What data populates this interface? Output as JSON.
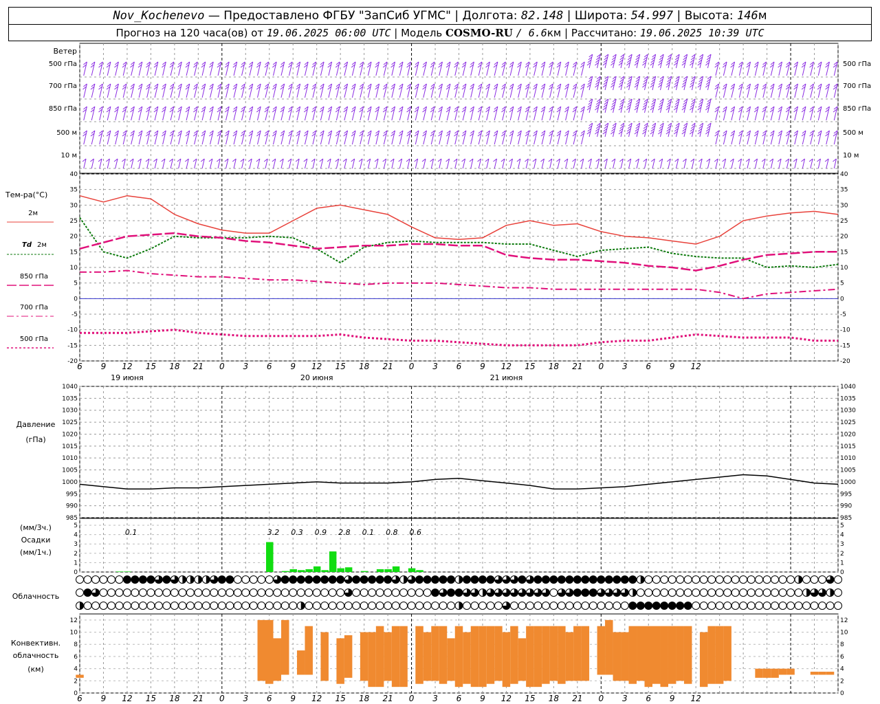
{
  "header": {
    "station": "Nov_Kochenevo",
    "provided_by": "— Предоставлено ФГБУ \"ЗапСиб УГМС\"",
    "lon_label": "Долгота:",
    "lon": "82.148",
    "lat_label": "Широта:",
    "lat": "54.997",
    "alt_label": "Высота:",
    "alt": "146",
    "alt_unit": "м",
    "forecast_prefix": "Прогноз на 120 часа(ов) от",
    "run_time": "19.06.2025 06:00 UTC",
    "model_label": "| Модель",
    "model": "COSMO-RU",
    "model_res": "/ 6.6",
    "model_res_unit": "км",
    "calc_label": "| Рассчитано:",
    "calc_time": "19.06.2025 10:39 UTC"
  },
  "colors": {
    "t2m": "#e8413a",
    "td2m": "#0d7a0d",
    "t850": "#e0107a",
    "t700": "#e0107a",
    "t500": "#e0107a",
    "wind": "#8a2be2",
    "precip": "#11dd11",
    "convective": "#f08a30",
    "pressure": "#000000",
    "zero_line": "#3333cc"
  },
  "chart_data": [
    {
      "type": "wind_barbs",
      "title": "Ветер",
      "levels": [
        "500 гПа",
        "700 гПа",
        "850 гПа",
        "500 м",
        "10 м"
      ],
      "speed_range_ms": [
        0,
        25
      ]
    },
    {
      "type": "line",
      "ylabel": "Тем-ра(°С)",
      "ylim": [
        -20,
        40
      ],
      "yticks": [
        -20,
        -15,
        -10,
        -5,
        0,
        5,
        10,
        15,
        20,
        25,
        30,
        35,
        40
      ],
      "x_hours": [
        0,
        3,
        6,
        9,
        12,
        15,
        18,
        21,
        24,
        27,
        30,
        33,
        36,
        39,
        42,
        45,
        48,
        51,
        54,
        57,
        60,
        63,
        66,
        69,
        72,
        75,
        78
      ],
      "series": [
        {
          "name": "2м",
          "values": [
            33,
            31,
            33,
            32,
            27,
            24,
            22,
            21,
            21,
            25,
            29,
            30,
            28.5,
            27,
            23,
            19.5,
            19,
            19.5,
            23.5,
            25,
            23.5,
            24,
            21.5,
            20,
            19.5,
            18.5,
            17.5
          ]
        },
        {
          "name": "Td 2м",
          "values": [
            26,
            15,
            13,
            16,
            20,
            19.5,
            19.5,
            19.5,
            20,
            19.5,
            16,
            11.5,
            16.5,
            18,
            18.5,
            18,
            18,
            18,
            17.5,
            17.5,
            15.5,
            13.5,
            15.5,
            16,
            16.5,
            14.5,
            13.5
          ]
        },
        {
          "name": "850 гПа",
          "values": [
            16,
            18,
            20,
            20.5,
            21,
            20,
            19.5,
            18.5,
            18,
            17,
            16,
            16.5,
            17,
            17,
            17.5,
            17.5,
            17,
            17,
            14,
            13,
            12.5,
            12.5,
            12,
            11.5,
            10.5,
            10,
            9
          ]
        },
        {
          "name": "700 гПа",
          "values": [
            8.5,
            8.5,
            9,
            8,
            7.5,
            7,
            7,
            6.5,
            6,
            6,
            5.5,
            5,
            4.5,
            5,
            5,
            5,
            4.5,
            4,
            3.5,
            3.5,
            3,
            3,
            3,
            3,
            3,
            3,
            3
          ]
        },
        {
          "name": "500 гПа",
          "values": [
            -11,
            -11,
            -11,
            -10.5,
            -10,
            -11,
            -11.5,
            -12,
            -12,
            -12,
            -12,
            -11.5,
            -12.5,
            -13,
            -13.5,
            -13.5,
            -14,
            -14.5,
            -15,
            -15,
            -15,
            -15,
            -14,
            -13.5,
            -13.5,
            -12.5,
            -11.5
          ]
        }
      ],
      "tail_hours": [
        81,
        84,
        87,
        90,
        93,
        96
      ],
      "tail": {
        "2м": [
          20,
          25,
          26.5,
          27.5,
          28,
          27
        ],
        "Td 2м": [
          13,
          13,
          10,
          10.5,
          10,
          11
        ],
        "850 гПа": [
          10.5,
          12.5,
          14,
          14.5,
          15,
          15
        ],
        "700 гПа": [
          2,
          0,
          1.5,
          2,
          2.5,
          3
        ],
        "500 гПа": [
          -12,
          -12.5,
          -12.5,
          -12.5,
          -13.5,
          -13.5
        ]
      }
    },
    {
      "type": "line",
      "title": "Давление",
      "ylabel": "(гПа)",
      "ylim": [
        985,
        1040
      ],
      "yticks": [
        985,
        990,
        995,
        1000,
        1005,
        1010,
        1015,
        1020,
        1025,
        1030,
        1035,
        1040
      ],
      "x_hours": [
        0,
        3,
        6,
        9,
        12,
        15,
        18,
        21,
        24,
        27,
        30,
        33,
        36,
        39,
        42,
        45,
        48,
        51,
        54,
        57,
        60,
        63,
        66,
        69,
        72,
        75,
        78,
        81,
        84,
        87,
        90,
        93,
        96
      ],
      "values": [
        999,
        998,
        997,
        997,
        997.5,
        997.5,
        998,
        998.5,
        999,
        999.5,
        1000,
        999.5,
        999.5,
        999.5,
        1000,
        1001,
        1001.5,
        1000.5,
        999.5,
        998.5,
        997,
        997,
        997.5,
        998,
        999,
        1000,
        1001,
        1002,
        1003,
        1002.5,
        1001,
        999.5,
        999
      ]
    },
    {
      "type": "bar",
      "title": "Осадки",
      "ylabel_3h": "(мм/3ч.)",
      "ylabel_1h": "(мм/1ч.)",
      "ylim": [
        0,
        5
      ],
      "yticks": [
        0,
        1,
        2,
        3,
        4,
        5
      ],
      "totals_3h": [
        {
          "hour": 6,
          "label": "0.1"
        },
        {
          "hour": 24,
          "label": "3.2"
        },
        {
          "hour": 27,
          "label": "0.3"
        },
        {
          "hour": 30,
          "label": "0.9"
        },
        {
          "hour": 33,
          "label": "2.8"
        },
        {
          "hour": 36,
          "label": "0.1"
        },
        {
          "hour": 39,
          "label": "0.8"
        },
        {
          "hour": 42,
          "label": "0.6"
        }
      ],
      "hourly": [
        {
          "hour": 5,
          "value": 0.05
        },
        {
          "hour": 6,
          "value": 0.05
        },
        {
          "hour": 24,
          "value": 3.2
        },
        {
          "hour": 26,
          "value": 0.1
        },
        {
          "hour": 27,
          "value": 0.3
        },
        {
          "hour": 28,
          "value": 0.2
        },
        {
          "hour": 29,
          "value": 0.3
        },
        {
          "hour": 30,
          "value": 0.6
        },
        {
          "hour": 31,
          "value": 0.2
        },
        {
          "hour": 32,
          "value": 2.2
        },
        {
          "hour": 33,
          "value": 0.4
        },
        {
          "hour": 34,
          "value": 0.5
        },
        {
          "hour": 36,
          "value": 0.1
        },
        {
          "hour": 38,
          "value": 0.3
        },
        {
          "hour": 39,
          "value": 0.3
        },
        {
          "hour": 40,
          "value": 0.6
        },
        {
          "hour": 42,
          "value": 0.4
        },
        {
          "hour": 43,
          "value": 0.2
        }
      ]
    },
    {
      "type": "table",
      "title": "Облачность",
      "rows": [
        "upper",
        "middle",
        "lower"
      ],
      "legend": "0 = clear, 1 = quarter, 2 = half, 3 = three-quarter, 4 = overcast"
    },
    {
      "type": "bar",
      "title": "Конвективн.",
      "ylabel": "облачность",
      "unit": "(км)",
      "ylim": [
        0,
        13
      ],
      "yticks": [
        0,
        2,
        4,
        6,
        8,
        10,
        12
      ],
      "columns": [
        {
          "hour": 0,
          "base": 2.5,
          "top": 3
        },
        {
          "hour": 23,
          "base": 2,
          "top": 12
        },
        {
          "hour": 24,
          "base": 1.5,
          "top": 12
        },
        {
          "hour": 25,
          "base": 2,
          "top": 9
        },
        {
          "hour": 26,
          "base": 3,
          "top": 12
        },
        {
          "hour": 28,
          "base": 3,
          "top": 7
        },
        {
          "hour": 29,
          "base": 3,
          "top": 11
        },
        {
          "hour": 31,
          "base": 2,
          "top": 10
        },
        {
          "hour": 33,
          "base": 1.5,
          "top": 9
        },
        {
          "hour": 34,
          "base": 2.5,
          "top": 9.5
        },
        {
          "hour": 36,
          "base": 2,
          "top": 10
        },
        {
          "hour": 37,
          "base": 1,
          "top": 10
        },
        {
          "hour": 38,
          "base": 1,
          "top": 11
        },
        {
          "hour": 39,
          "base": 2,
          "top": 10
        },
        {
          "hour": 40,
          "base": 1,
          "top": 11
        },
        {
          "hour": 41,
          "base": 1,
          "top": 11
        },
        {
          "hour": 43,
          "base": 1.5,
          "top": 11
        },
        {
          "hour": 44,
          "base": 2,
          "top": 10
        },
        {
          "hour": 45,
          "base": 2,
          "top": 11
        },
        {
          "hour": 46,
          "base": 1.5,
          "top": 11
        },
        {
          "hour": 47,
          "base": 2,
          "top": 9
        },
        {
          "hour": 48,
          "base": 1,
          "top": 11
        },
        {
          "hour": 49,
          "base": 1.5,
          "top": 10
        },
        {
          "hour": 50,
          "base": 1,
          "top": 11
        },
        {
          "hour": 51,
          "base": 1,
          "top": 11
        },
        {
          "hour": 52,
          "base": 1.5,
          "top": 11
        },
        {
          "hour": 53,
          "base": 2,
          "top": 11
        },
        {
          "hour": 54,
          "base": 1,
          "top": 10
        },
        {
          "hour": 55,
          "base": 1.5,
          "top": 11
        },
        {
          "hour": 56,
          "base": 2,
          "top": 9
        },
        {
          "hour": 57,
          "base": 1,
          "top": 11
        },
        {
          "hour": 58,
          "base": 1,
          "top": 11
        },
        {
          "hour": 59,
          "base": 1.5,
          "top": 11
        },
        {
          "hour": 60,
          "base": 2,
          "top": 11
        },
        {
          "hour": 61,
          "base": 1.5,
          "top": 11
        },
        {
          "hour": 62,
          "base": 2,
          "top": 10
        },
        {
          "hour": 63,
          "base": 2,
          "top": 11
        },
        {
          "hour": 64,
          "base": 2,
          "top": 11
        },
        {
          "hour": 66,
          "base": 3,
          "top": 11
        },
        {
          "hour": 67,
          "base": 3,
          "top": 12
        },
        {
          "hour": 68,
          "base": 2,
          "top": 10
        },
        {
          "hour": 69,
          "base": 2,
          "top": 10
        },
        {
          "hour": 70,
          "base": 1.5,
          "top": 11
        },
        {
          "hour": 71,
          "base": 2,
          "top": 11
        },
        {
          "hour": 72,
          "base": 1,
          "top": 11
        },
        {
          "hour": 73,
          "base": 1.5,
          "top": 11
        },
        {
          "hour": 74,
          "base": 1,
          "top": 11
        },
        {
          "hour": 75,
          "base": 1.5,
          "top": 11
        },
        {
          "hour": 76,
          "base": 2,
          "top": 11
        },
        {
          "hour": 77,
          "base": 1.5,
          "top": 11
        },
        {
          "hour": 79,
          "base": 1,
          "top": 10
        },
        {
          "hour": 80,
          "base": 1.5,
          "top": 11
        },
        {
          "hour": 81,
          "base": 1.5,
          "top": 11
        },
        {
          "hour": 82,
          "base": 2,
          "top": 11
        },
        {
          "hour": 86,
          "base": 2.5,
          "top": 4
        },
        {
          "hour": 87,
          "base": 2.5,
          "top": 4
        },
        {
          "hour": 88,
          "base": 2.5,
          "top": 4
        },
        {
          "hour": 89,
          "base": 3,
          "top": 4
        },
        {
          "hour": 90,
          "base": 3,
          "top": 4
        },
        {
          "hour": 93,
          "base": 3,
          "top": 3.5
        },
        {
          "hour": 94,
          "base": 3,
          "top": 3.5
        },
        {
          "hour": 95,
          "base": 3,
          "top": 3.5
        }
      ]
    }
  ],
  "axis": {
    "hour_labels": [
      "6",
      "9",
      "12",
      "15",
      "18",
      "21",
      "0",
      "3",
      "6",
      "9",
      "12",
      "15",
      "18",
      "21",
      "0",
      "3",
      "6",
      "9",
      "12",
      "15",
      "18",
      "21",
      "0",
      "3",
      "6",
      "9",
      "12"
    ],
    "day_labels": [
      "19 июня",
      "20 июня",
      "21 июня"
    ]
  },
  "labels": {
    "wind_title": "Ветер",
    "wind_levels": [
      "500 гПа",
      "700 гПа",
      "850 гПа",
      "500 м",
      "10 м"
    ],
    "temp_title": "Тем-ра(°С)",
    "legend_2m": "2м",
    "legend_td": "Td",
    "legend_td2": "2м",
    "legend_850": "850 гПа",
    "legend_700": "700 гПа",
    "legend_500": "500 гПа",
    "press_title": "Давление",
    "press_unit": "(гПа)",
    "precip_3h": "(мм/3ч.)",
    "precip_title": "Осадки",
    "precip_1h": "(мм/1ч.)",
    "cloud_title": "Облачность",
    "conv1": "Конвективн.",
    "conv2": "облачность",
    "conv3": "(км)"
  }
}
